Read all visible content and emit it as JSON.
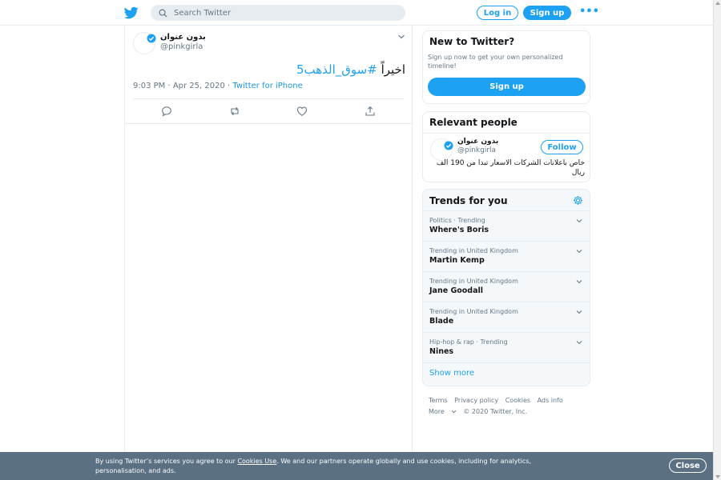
{
  "header": {
    "logo_icon": "twitter-bird-icon",
    "search": {
      "placeholder": "Search Twitter",
      "value": ""
    },
    "login_label": "Log in",
    "signup_label": "Sign up",
    "more_label": "•••"
  },
  "tweet": {
    "author_name": "بدون عنوان",
    "author_handle": "@pinkgirla",
    "verified": true,
    "text_prefix": "اخيراً",
    "hashtag": "#سوق_الذهب5",
    "time": "9:03 PM · Apr 25, 2020 · ",
    "source": "Twitter for iPhone",
    "actions": [
      "reply-icon",
      "retweet-icon",
      "like-icon",
      "share-icon"
    ]
  },
  "new_to_twitter": {
    "title": "New to Twitter?",
    "description": "Sign up now to get your own personalized timeline!",
    "signup_label": "Sign up"
  },
  "relevant_people": {
    "title": "Relevant people",
    "name": "بدون عنوان",
    "handle": "@pinkgirla",
    "follow_label": "Follow",
    "bio": "خاص باعلانات الشركات الاسعار تبدا من 190 الف ريال"
  },
  "trends": {
    "title": "Trends for you",
    "items": [
      {
        "context": "Politics · Trending",
        "name": "Where's Boris"
      },
      {
        "context": "Trending in United Kingdom",
        "name": "Martin Kemp"
      },
      {
        "context": "Trending in United Kingdom",
        "name": "Jane Goodall"
      },
      {
        "context": "Trending in United Kingdom",
        "name": "Blade"
      },
      {
        "context": "Hip-hop & rap · Trending",
        "name": "Nines"
      }
    ],
    "show_more": "Show more"
  },
  "footer": {
    "links": [
      "Terms",
      "Privacy policy",
      "Cookies",
      "Ads info"
    ],
    "more": "More",
    "copyright": "© 2020 Twitter, Inc."
  },
  "cookie_banner": {
    "text_before": "By using Twitter’s services you agree to our ",
    "link": "Cookies Use",
    "text_after": ". We and our partners operate globally and use cookies, including for analytics, personalisation, and ads.",
    "close_label": "Close"
  },
  "colors": {
    "brand_blue": "#1da1f2",
    "banner_bg": "#5b7083",
    "secondary_text": "#657786"
  }
}
